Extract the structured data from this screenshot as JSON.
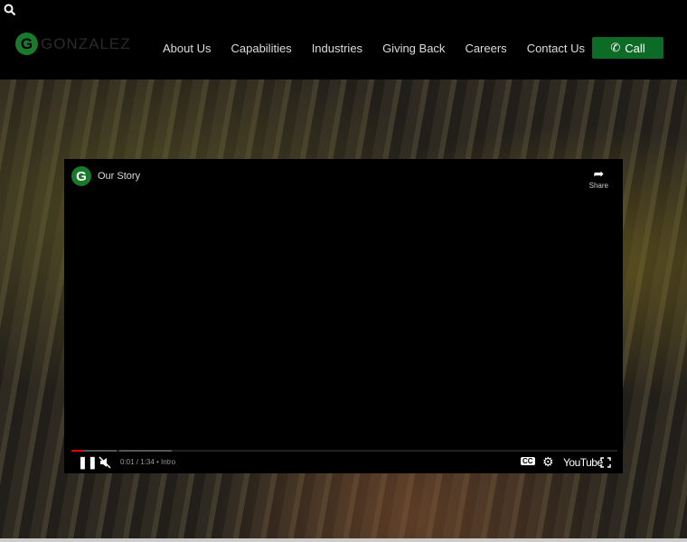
{
  "header": {
    "logo_letter": "G",
    "logo_text": "GONZALEZ",
    "call_label": "Call",
    "nav": [
      "About Us",
      "Capabilities",
      "Industries",
      "Giving Back",
      "Careers",
      "Contact Us"
    ]
  },
  "video": {
    "channel_letter": "G",
    "title": "Our Story",
    "share_label": "Share",
    "time": "0:01 / 1:34 • Intro",
    "youtube_label": "YouTube",
    "progress_fraction": 0.01
  }
}
